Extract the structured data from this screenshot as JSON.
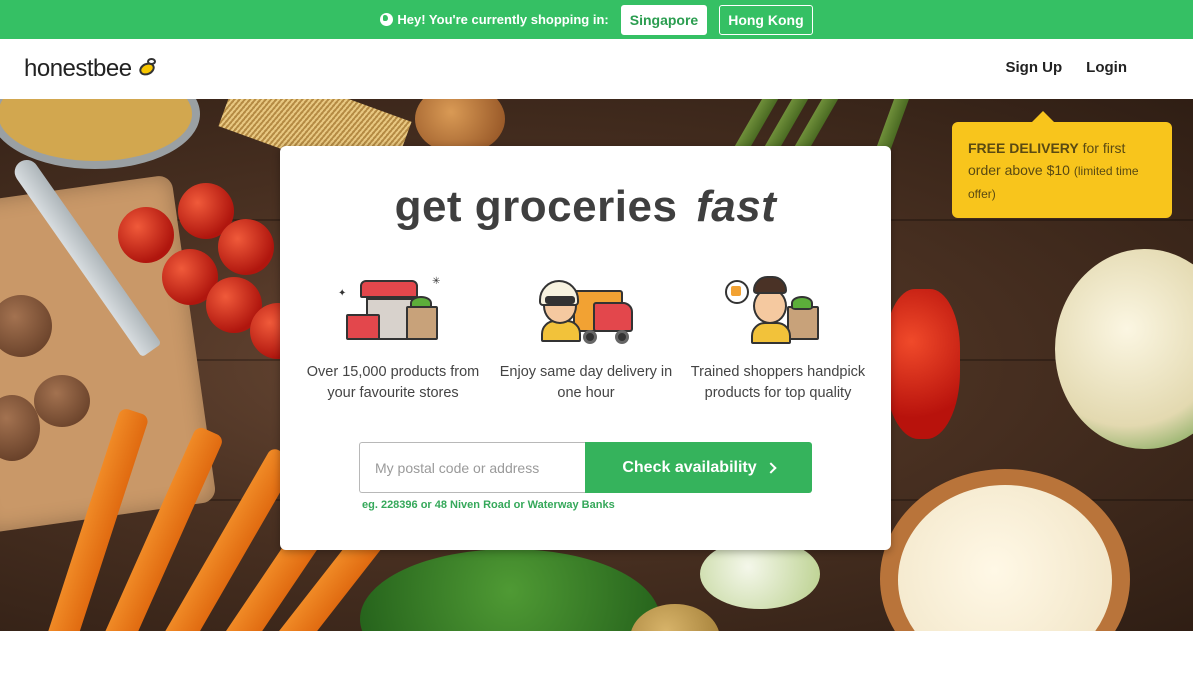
{
  "banner": {
    "message": "Hey! You're currently shopping in:",
    "regions": [
      {
        "label": "Singapore",
        "selected": true
      },
      {
        "label": "Hong Kong",
        "selected": false
      }
    ],
    "background": "#35c064"
  },
  "header": {
    "logo_text": "honestbee",
    "logo_icon": "bee-icon",
    "nav": {
      "signup": "Sign Up",
      "login": "Login"
    }
  },
  "promo": {
    "strong": "FREE DELIVERY",
    "text": "for first order above $10",
    "small": "(limited time offer)",
    "color": "#f8c51c"
  },
  "card": {
    "headline_main": "get groceries",
    "headline_emphasis": "fast",
    "features": [
      {
        "icon": "store-icon",
        "text": "Over 15,000 products from your favourite stores"
      },
      {
        "icon": "delivery-truck-icon",
        "text": "Enjoy same day delivery in one hour"
      },
      {
        "icon": "shopper-icon",
        "text": "Trained shoppers handpick products for top quality"
      }
    ],
    "search": {
      "placeholder": "My postal code or address",
      "value": "",
      "button_label": "Check availability",
      "hint": "eg. 228396 or 48 Niven Road or Waterway Banks"
    },
    "accent": "#35b35c"
  }
}
